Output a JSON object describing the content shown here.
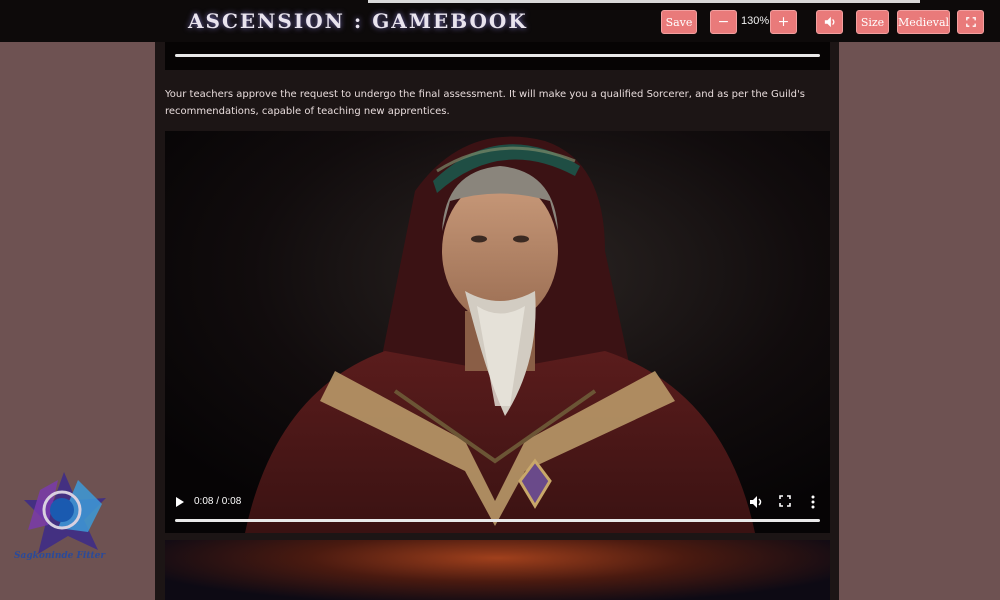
{
  "header": {
    "title": "ASCENSION : GAMEBOOK",
    "save_label": "Save",
    "zoom_out_label": "−",
    "zoom_level": "130%",
    "zoom_in_label": "+",
    "size_label": "Size",
    "theme_label": "Medieval"
  },
  "story": {
    "paragraph": "Your teachers approve the request to undergo the final assessment. It will make you a qualified Sorcerer, and as per the Guild's recommendations, capable of teaching new apprentices."
  },
  "video": {
    "time": "0:08 / 0:08",
    "progress_fraction": 1.0
  },
  "watermark": {
    "text": "Sagkoninde Fitter"
  },
  "colors": {
    "button": "#e97a7a",
    "background": "#6e5252",
    "column": "#1c1515"
  }
}
